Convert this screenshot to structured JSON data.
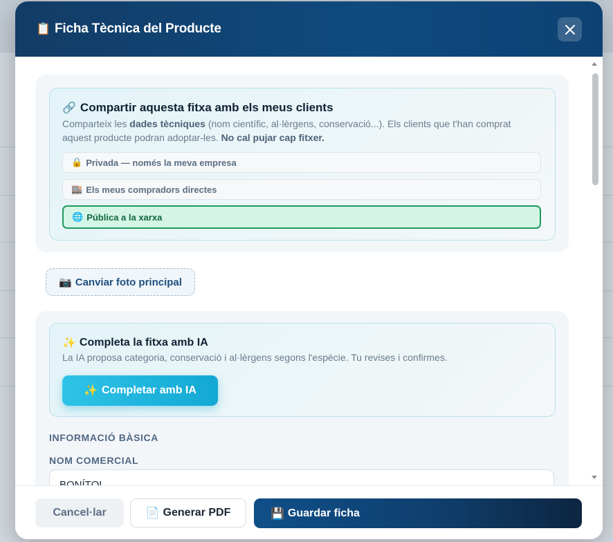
{
  "modal": {
    "title": "Ficha Tècnica del Producte",
    "title_icon": "clipboard-icon"
  },
  "share": {
    "title": "Compartir aquesta fitxa amb els meus clients",
    "desc_part1": "Comparteix les ",
    "desc_bold1": "dades tècniques",
    "desc_part2": " (nom científic, al·lèrgens, conservació...). Els clients que t'han comprat aquest producte podran adoptar-les. ",
    "desc_bold2": "No cal pujar cap fitxer.",
    "options": [
      {
        "label": "Privada — només la meva empresa",
        "icon": "lock-icon",
        "glyph": "🔒"
      },
      {
        "label": "Els meus compradors directes",
        "icon": "building-icon",
        "glyph": "🏬"
      },
      {
        "label": "Pública a la xarxa",
        "icon": "globe-icon",
        "glyph": "🌐"
      }
    ],
    "selected": "Pública a la xarxa"
  },
  "photo": {
    "label": "Canviar foto principal",
    "icon": "camera-icon"
  },
  "ai": {
    "title": "Completa la fitxa amb IA",
    "desc": "La IA proposa categoria, conservació i al·lèrgens segons l'espècie. Tu revises i confirmes.",
    "button": "Completar amb IA",
    "icon": "sparkles-icon"
  },
  "basic": {
    "heading": "INFORMACIÓ BÀSICA",
    "commercial_name_label": "NOM COMERCIAL",
    "commercial_name_value": "BONÍTOL"
  },
  "footer": {
    "cancel": "Cancel·lar",
    "pdf": "Generar PDF",
    "save": "Guardar ficha"
  },
  "colors": {
    "header": "#123c66",
    "accent_cyan": "#13a8d3",
    "selected_green": "#1d9a5e"
  }
}
